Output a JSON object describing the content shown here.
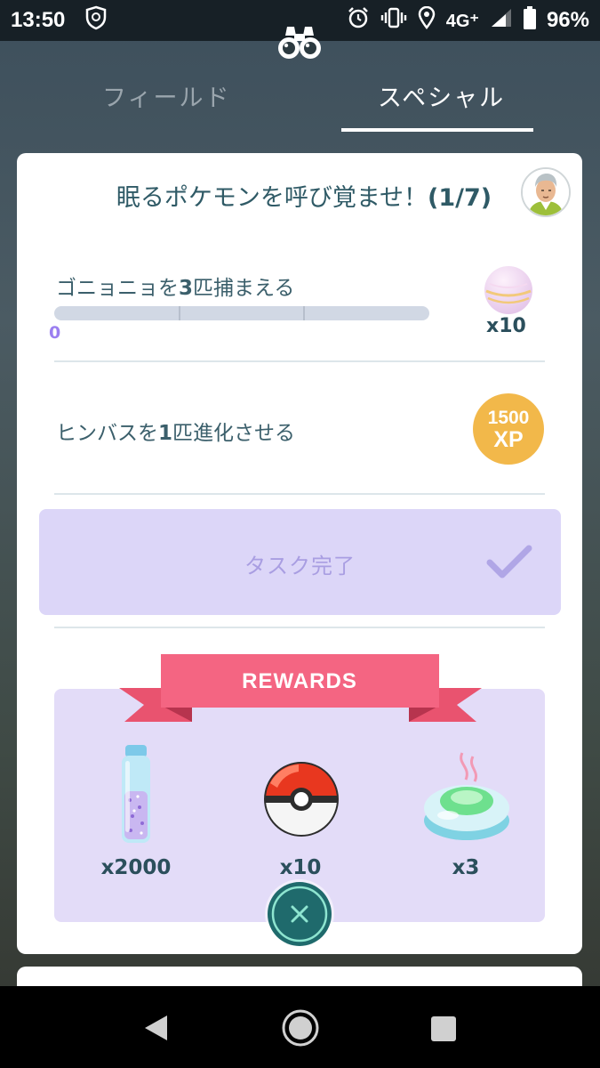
{
  "status_bar": {
    "time": "13:50",
    "network": "4G⁺",
    "battery": "96%"
  },
  "tabs": {
    "field": "フィールド",
    "special": "スペシャル"
  },
  "quest": {
    "title": "眠るポケモンを呼び覚ませ！",
    "step": "(1/7)",
    "tasks": [
      {
        "label_pre": "ゴニョニョを",
        "label_num": "3",
        "label_post": "匹捕まえる",
        "progress_text": "0",
        "progress": 0,
        "reward_qty": "x10"
      },
      {
        "label_pre": "ヒンバスを",
        "label_num": "1",
        "label_post": "匹進化させる",
        "reward_xp_amount": "1500",
        "reward_xp_unit": "XP"
      }
    ],
    "complete_button": "タスク完了"
  },
  "rewards": {
    "title": "REWARDS",
    "items": [
      {
        "icon": "stardust-icon",
        "qty": "x2000"
      },
      {
        "icon": "poke-ball-icon",
        "qty": "x10"
      },
      {
        "icon": "incense-icon",
        "qty": "x3"
      }
    ]
  },
  "colors": {
    "accent_purple": "#8e76e0",
    "complete_button_bg": "#dcd6f8",
    "ribbon_red": "#f05f7c",
    "xp_gold": "#f2b84a",
    "text_teal": "#2f5a66"
  }
}
